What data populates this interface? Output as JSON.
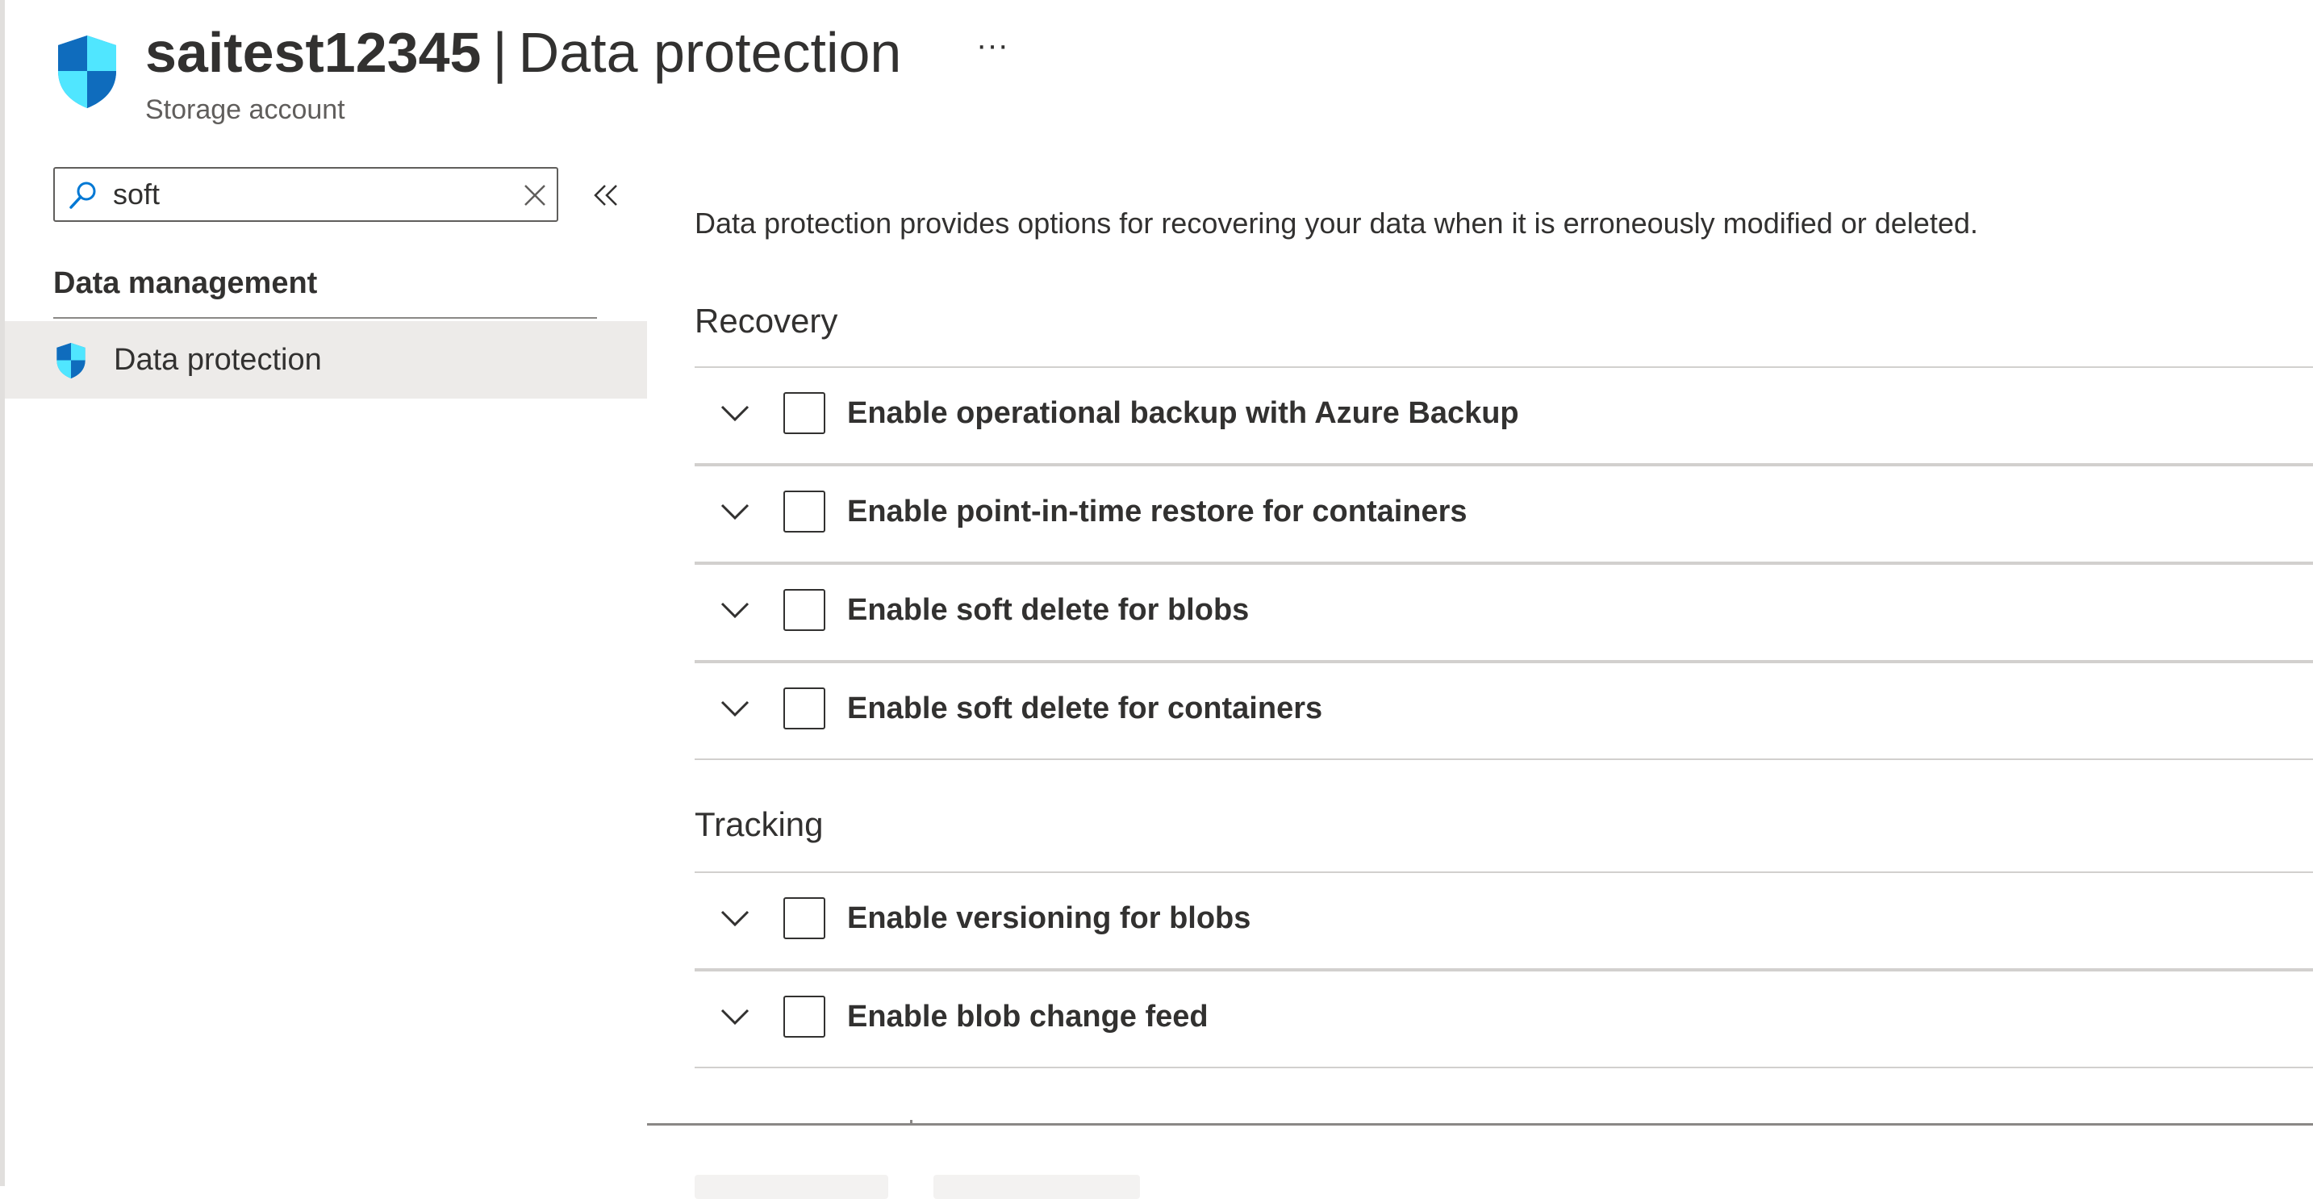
{
  "header": {
    "resource_name": "saitest12345",
    "separator": "|",
    "page_name": "Data protection",
    "subtitle": "Storage account",
    "more_label": "···",
    "icon": "shield-icon"
  },
  "sidebar": {
    "search": {
      "value": "soft",
      "placeholder": "Search"
    },
    "group_label": "Data management",
    "items": [
      {
        "label": "Data protection",
        "icon": "shield-icon",
        "selected": true
      }
    ]
  },
  "main": {
    "description": "Data protection provides options for recovering your data when it is erroneously modified or deleted.",
    "sections": [
      {
        "title": "Recovery",
        "options": [
          {
            "label": "Enable operational backup with Azure Backup",
            "checked": false
          },
          {
            "label": "Enable point-in-time restore for containers",
            "checked": false
          },
          {
            "label": "Enable soft delete for blobs",
            "checked": false
          },
          {
            "label": "Enable soft delete for containers",
            "checked": false
          }
        ]
      },
      {
        "title": "Tracking",
        "options": [
          {
            "label": "Enable versioning for blobs",
            "checked": false
          },
          {
            "label": "Enable blob change feed",
            "checked": false
          }
        ]
      }
    ]
  },
  "colors": {
    "shield_primary": "#0078d4",
    "shield_light": "#50e6ff",
    "selected_bg": "#edebe9",
    "text": "#323130"
  }
}
